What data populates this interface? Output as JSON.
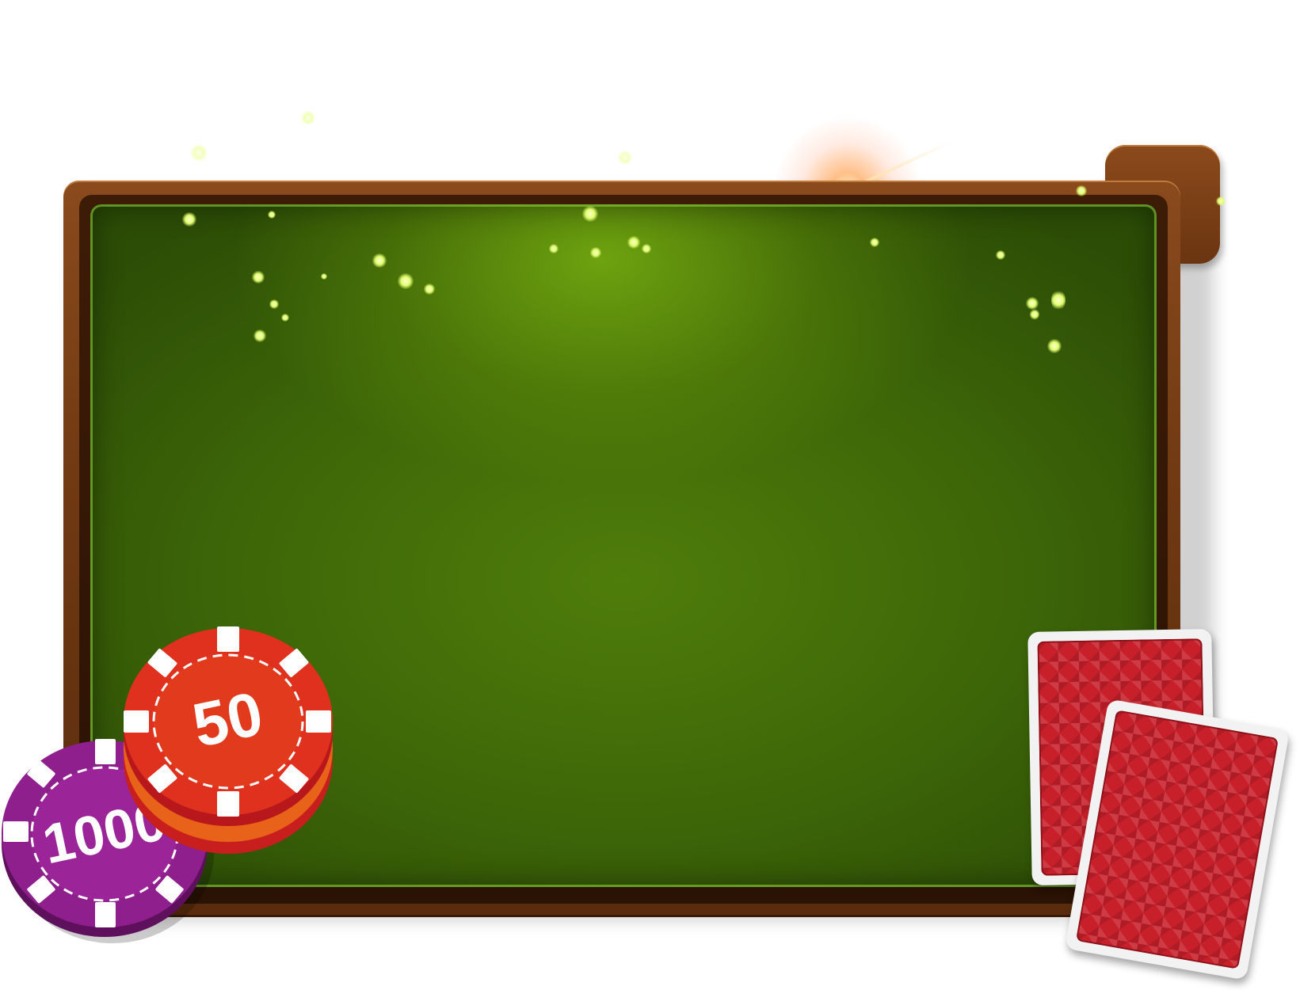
{
  "table": {
    "felt_color": "#4f7d0a",
    "frame_color": "#6e3812"
  },
  "chips": [
    {
      "label": "1000",
      "color": "#8e1f8c"
    },
    {
      "label": "50",
      "color": "#e0311e"
    }
  ],
  "cards": [
    {
      "face": "back",
      "color": "#c7202a"
    },
    {
      "face": "back",
      "color": "#c7202a"
    }
  ]
}
